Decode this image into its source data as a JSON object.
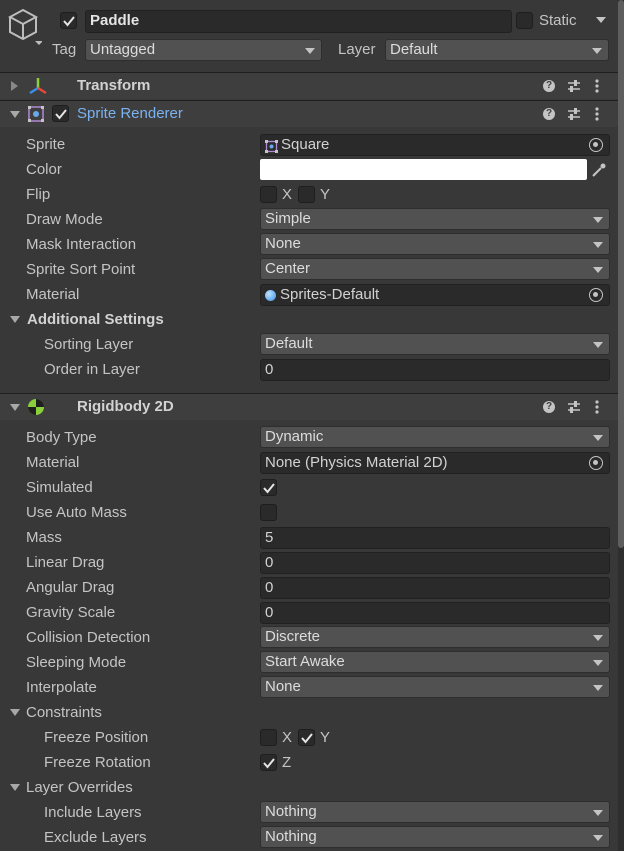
{
  "object": {
    "name": "Paddle",
    "active": true,
    "static_label": "Static",
    "static": false,
    "tag_label": "Tag",
    "tag_value": "Untagged",
    "layer_label": "Layer",
    "layer_value": "Default"
  },
  "transform": {
    "title": "Transform"
  },
  "sprite_renderer": {
    "title": "Sprite Renderer",
    "enabled": true,
    "props": {
      "sprite": {
        "label": "Sprite",
        "value": "Square"
      },
      "color": {
        "label": "Color",
        "value": "#ffffff"
      },
      "flip": {
        "label": "Flip",
        "x": "X",
        "y": "Y",
        "x_checked": false,
        "y_checked": false
      },
      "draw_mode": {
        "label": "Draw Mode",
        "value": "Simple"
      },
      "mask_interaction": {
        "label": "Mask Interaction",
        "value": "None"
      },
      "sprite_sort_point": {
        "label": "Sprite Sort Point",
        "value": "Center"
      },
      "material": {
        "label": "Material",
        "value": "Sprites-Default"
      }
    },
    "additional_settings": {
      "label": "Additional Settings",
      "sorting_layer": {
        "label": "Sorting Layer",
        "value": "Default"
      },
      "order_in_layer": {
        "label": "Order in Layer",
        "value": "0"
      }
    }
  },
  "rigidbody": {
    "title": "Rigidbody 2D",
    "props": {
      "body_type": {
        "label": "Body Type",
        "value": "Dynamic"
      },
      "material": {
        "label": "Material",
        "value": "None (Physics Material 2D)"
      },
      "simulated": {
        "label": "Simulated",
        "checked": true
      },
      "use_auto_mass": {
        "label": "Use Auto Mass",
        "checked": false
      },
      "mass": {
        "label": "Mass",
        "value": "5"
      },
      "linear_drag": {
        "label": "Linear Drag",
        "value": "0"
      },
      "angular_drag": {
        "label": "Angular Drag",
        "value": "0"
      },
      "gravity_scale": {
        "label": "Gravity Scale",
        "value": "0"
      },
      "collision_detection": {
        "label": "Collision Detection",
        "value": "Discrete"
      },
      "sleeping_mode": {
        "label": "Sleeping Mode",
        "value": "Start Awake"
      },
      "interpolate": {
        "label": "Interpolate",
        "value": "None"
      }
    },
    "constraints": {
      "label": "Constraints",
      "freeze_position": {
        "label": "Freeze Position",
        "x": "X",
        "y": "Y",
        "x_checked": false,
        "y_checked": true
      },
      "freeze_rotation": {
        "label": "Freeze Rotation",
        "z": "Z",
        "z_checked": true
      }
    },
    "layer_overrides": {
      "label": "Layer Overrides",
      "include_layers": {
        "label": "Include Layers",
        "value": "Nothing"
      },
      "exclude_layers": {
        "label": "Exclude Layers",
        "value": "Nothing"
      }
    }
  },
  "colors": {
    "background": "#383838",
    "header": "#3e3e3e",
    "accent_title": "#7bb2f0",
    "field": "#2a2a2a",
    "dropdown": "#515151"
  },
  "icons": [
    "gameobject-cube-icon",
    "help-icon",
    "presets-icon",
    "kebab-menu-icon",
    "transform-axes-icon",
    "sprite-renderer-icon",
    "rigidbody-icon",
    "eyedropper-icon",
    "object-picker-icon"
  ]
}
